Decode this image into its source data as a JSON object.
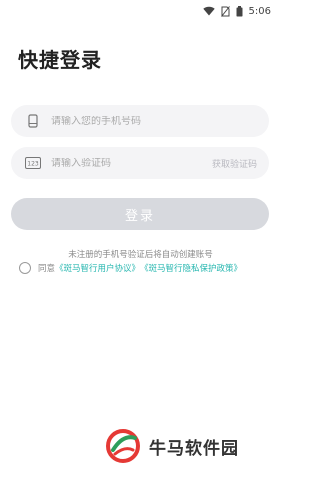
{
  "status_bar": {
    "time": "5:06",
    "icons": [
      "wifi-icon",
      "no-sim-icon",
      "battery-icon"
    ]
  },
  "page": {
    "title": "快捷登录"
  },
  "phone_field": {
    "icon": "phone-icon",
    "placeholder": "请输入您的手机号码",
    "value": ""
  },
  "code_field": {
    "icon": "code-123-icon",
    "placeholder": "请输入验证码",
    "value": "",
    "get_code_label": "获取验证码"
  },
  "login_button": {
    "label": "登录"
  },
  "notice": "未注册的手机号验证后将自动创建账号",
  "agreement": {
    "checked": false,
    "prefix": "同意",
    "user_agreement": "《斑马智行用户协议》",
    "privacy_policy": "《斑马智行隐私保护政策》"
  },
  "watermark": {
    "text": "牛马软件园"
  },
  "colors": {
    "accent": "#28b7b0",
    "button_disabled": "#d7d9de",
    "field_bg": "#f4f4f6"
  }
}
